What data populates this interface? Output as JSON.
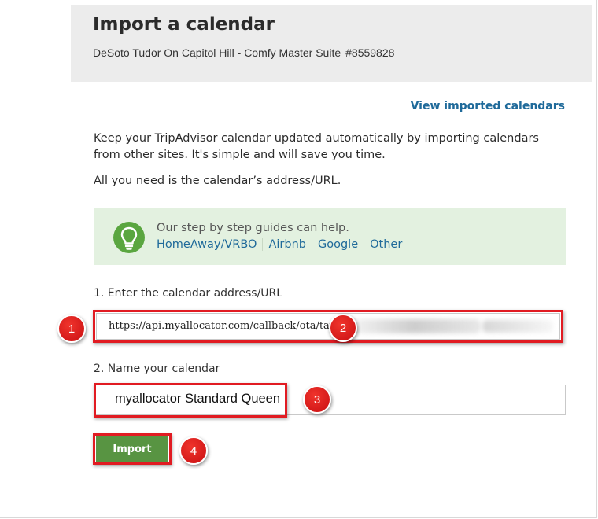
{
  "header": {
    "title": "Import a calendar",
    "property_name": "DeSoto Tudor On Capitol Hill - Comfy Master Suite",
    "property_code": "#8559828"
  },
  "view_imported_link": "View imported calendars",
  "intro": {
    "paragraph1": "Keep your TripAdvisor calendar updated automatically by importing calendars from other sites. It's simple and will save you time.",
    "paragraph2": "All you need is the calendar’s address/URL."
  },
  "tip": {
    "icon": "lightbulb-icon",
    "text": "Our step by step guides can help.",
    "links": [
      "HomeAway/VRBO",
      "Airbnb",
      "Google",
      "Other"
    ]
  },
  "step1": {
    "label": "1. Enter the calendar address/URL",
    "value": "https://api.myallocator.com/callback/ota/tavr/"
  },
  "step2": {
    "label": "2. Name your calendar",
    "value": "myallocator Standard Queen"
  },
  "import_button": "Import",
  "annotations": [
    "1",
    "2",
    "3",
    "4"
  ],
  "colors": {
    "accent_green": "#589442",
    "link_blue": "#1f6a9a",
    "highlight_red": "#e11b22",
    "tip_background": "#e3f1e0"
  }
}
